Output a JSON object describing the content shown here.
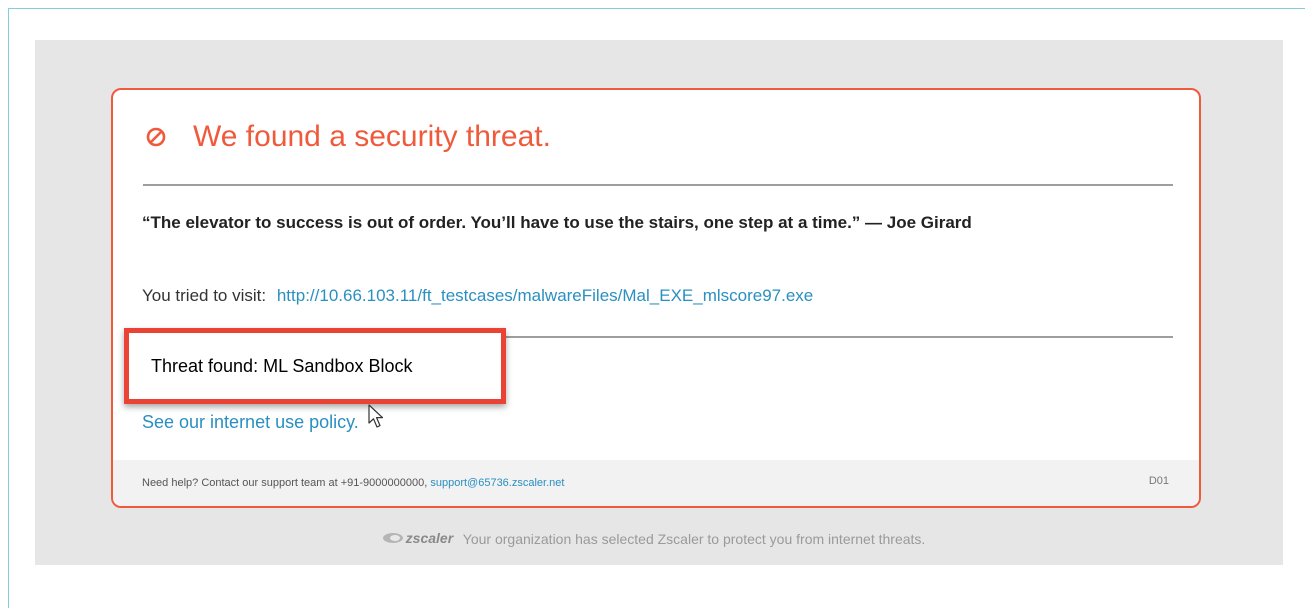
{
  "block_page": {
    "title": "We found a security threat.",
    "quote": "“The elevator to success is out of order. You’ll have to use the stairs, one step at a time.” — Joe Girard",
    "visit_label": "You tried to visit:",
    "visit_url": "http://10.66.103.11/ft_testcases/malwareFiles/Mal_EXE_mlscore97.exe",
    "policy_link": "See our internet use policy.",
    "footer": {
      "help_text": "Need help? Contact our support team at +91-9000000000,",
      "email": "support@65736.zscaler.net",
      "code": "D01"
    }
  },
  "annotation": {
    "threat_found": "Threat found: ML Sandbox Block"
  },
  "branding": {
    "logo": "zscaler",
    "message": "Your organization has selected Zscaler to protect you from internet threats."
  },
  "colors": {
    "accent": "#f05a3c",
    "link": "#2a8fc1",
    "highlight_border": "#ea4335"
  },
  "icons": {
    "block": "block-icon",
    "cursor": "cursor-icon",
    "logo": "zscaler-logo-icon"
  }
}
